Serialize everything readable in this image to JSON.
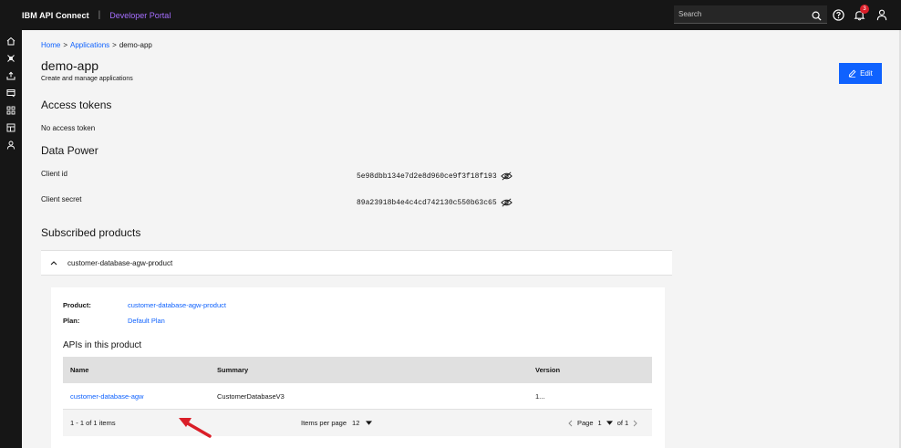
{
  "header": {
    "brand": "IBM API Connect",
    "separator": "|",
    "product": "Developer Portal",
    "search_placeholder": "Search",
    "notification_count": "3"
  },
  "breadcrumb": {
    "home": "Home",
    "applications": "Applications",
    "current": "demo-app",
    "sep": ">"
  },
  "page": {
    "title": "demo-app",
    "subtitle": "Create and manage applications",
    "edit_label": "Edit"
  },
  "access_tokens": {
    "heading": "Access tokens",
    "empty": "No access token"
  },
  "data_power": {
    "heading": "Data Power",
    "client_id_label": "Client id",
    "client_id_value": "5e98dbb134e7d2e8d960ce9f3f18f193",
    "client_secret_label": "Client secret",
    "client_secret_value": "89a23918b4e4c4cd742130c550b63c65"
  },
  "subscribed": {
    "heading": "Subscribed products",
    "accordion_title": "customer-database-agw-product",
    "product_label": "Product:",
    "product_value": "customer-database-agw-product",
    "plan_label": "Plan:",
    "plan_value": "Default Plan",
    "apis_heading": "APIs in this product",
    "columns": [
      "Name",
      "Summary",
      "Version"
    ],
    "rows": [
      {
        "name": "customer-database-agw",
        "summary": "CustomerDatabaseV3",
        "version": "1..."
      }
    ],
    "pagination": {
      "range": "1 - 1 of 1 items",
      "items_per_page_label": "Items per page",
      "items_per_page": "12",
      "page_label": "Page",
      "page": "1",
      "of_pages": "of 1"
    }
  },
  "colors": {
    "accent": "#0f62fe",
    "header_bg": "#161616",
    "product_purple": "#a56eff",
    "arrow_red": "#da1e28"
  }
}
